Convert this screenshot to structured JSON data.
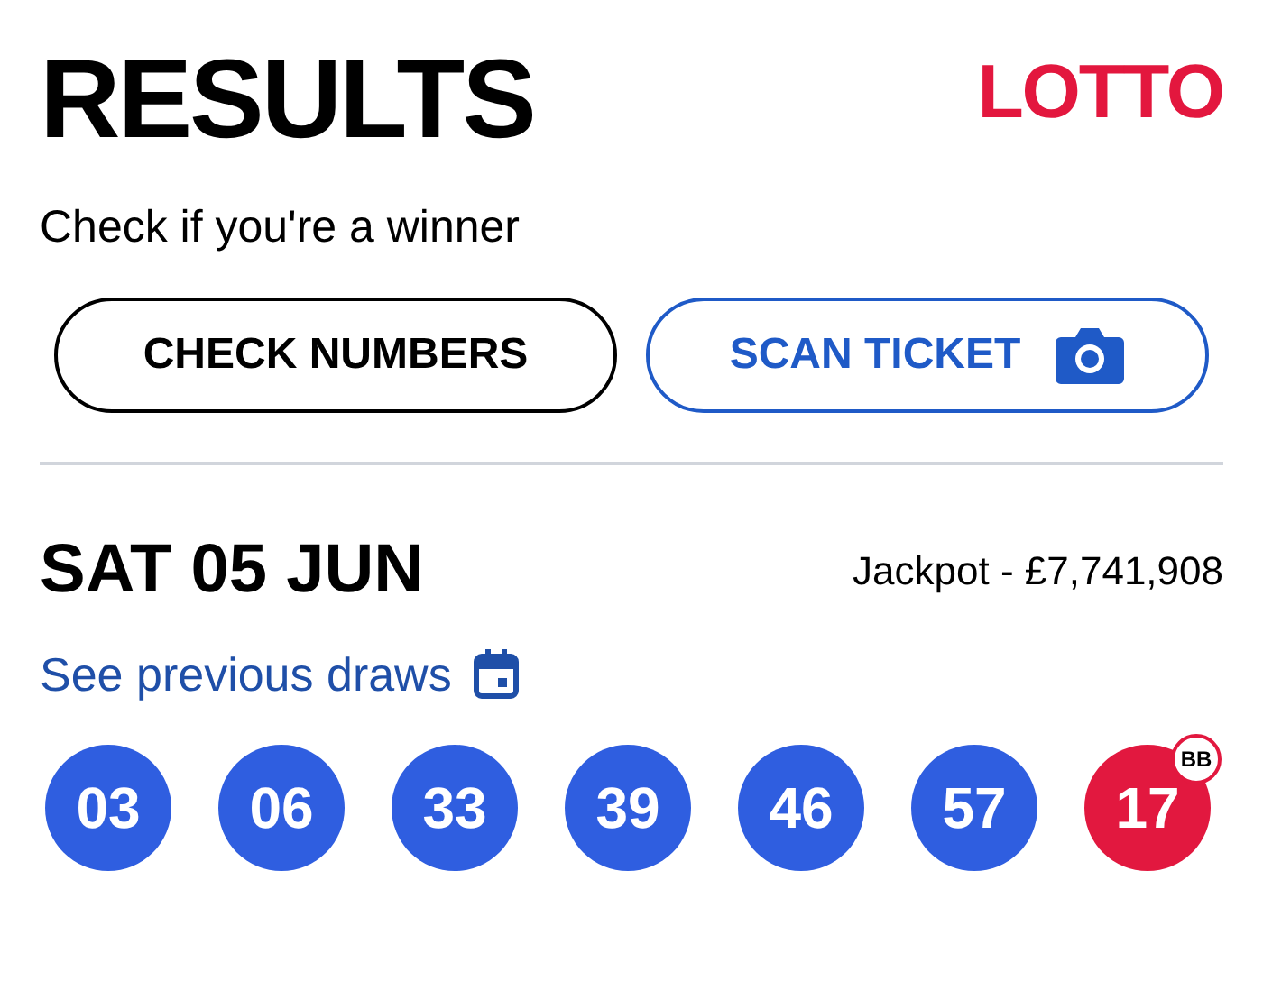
{
  "header": {
    "title": "RESULTS",
    "logo": "LOTTO",
    "subtitle": "Check if you're a winner"
  },
  "buttons": [
    {
      "label": "CHECK NUMBERS",
      "kind": "outline"
    },
    {
      "label": "SCAN TICKET",
      "kind": "scan"
    }
  ],
  "draw": {
    "date": "SAT 05 JUN",
    "jackpot": "Jackpot - £7,741,908",
    "previous_link": "See previous draws"
  },
  "balls": [
    {
      "number": "03",
      "kind": "main"
    },
    {
      "number": "06",
      "kind": "main"
    },
    {
      "number": "33",
      "kind": "main"
    },
    {
      "number": "39",
      "kind": "main"
    },
    {
      "number": "46",
      "kind": "main"
    },
    {
      "number": "57",
      "kind": "main"
    },
    {
      "number": "17",
      "kind": "bonus",
      "badge": "BB"
    }
  ]
}
